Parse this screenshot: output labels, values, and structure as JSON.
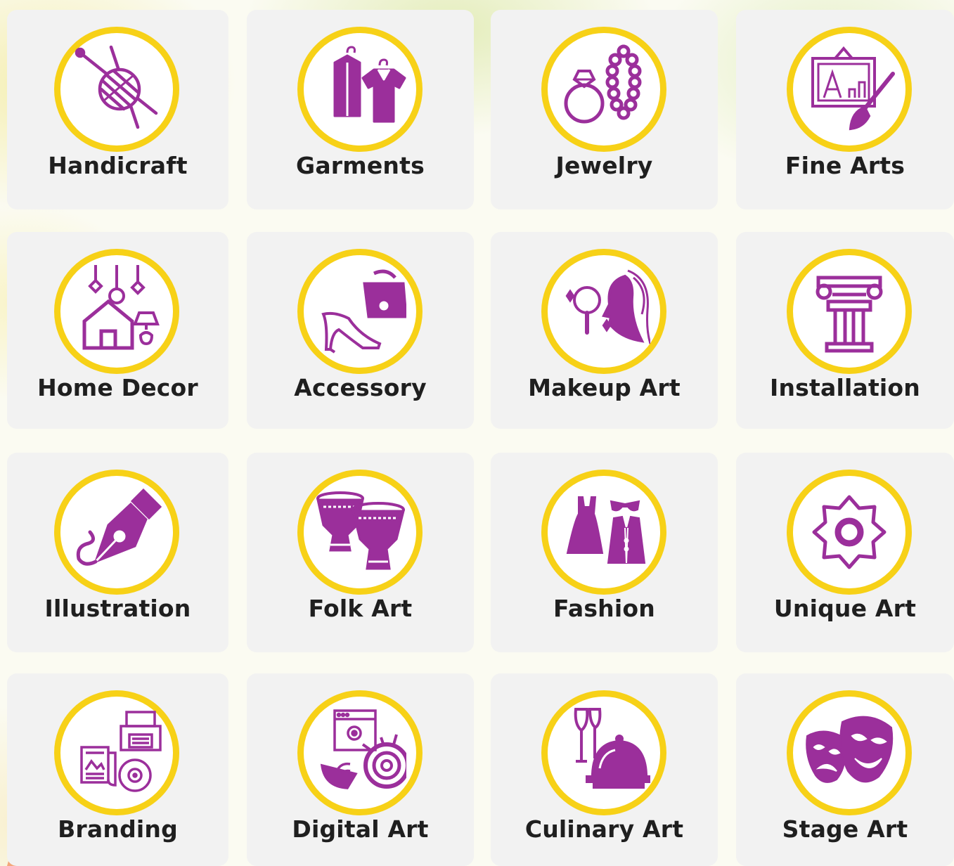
{
  "categories": [
    {
      "label": "Handicraft",
      "icon": "yarn-needles-icon"
    },
    {
      "label": "Garments",
      "icon": "hanging-clothes-icon"
    },
    {
      "label": "Jewelry",
      "icon": "ring-necklace-icon"
    },
    {
      "label": "Fine Arts",
      "icon": "painting-brush-icon"
    },
    {
      "label": "Home Decor",
      "icon": "house-lamps-icon"
    },
    {
      "label": "Accessory",
      "icon": "handbag-heel-icon"
    },
    {
      "label": "Makeup Art",
      "icon": "mirror-face-icon"
    },
    {
      "label": "Installation",
      "icon": "column-pillar-icon"
    },
    {
      "label": "Illustration",
      "icon": "pen-nib-icon"
    },
    {
      "label": "Folk Art",
      "icon": "drums-icon"
    },
    {
      "label": "Fashion",
      "icon": "dress-suit-icon"
    },
    {
      "label": "Unique Art",
      "icon": "flower-badge-icon"
    },
    {
      "label": "Branding",
      "icon": "printer-media-icon"
    },
    {
      "label": "Digital Art",
      "icon": "web-design-icon"
    },
    {
      "label": "Culinary Art",
      "icon": "wine-cloche-icon"
    },
    {
      "label": "Stage Art",
      "icon": "theater-masks-icon"
    }
  ],
  "colors": {
    "ring": "#f7d117",
    "icon": "#9b2f9b",
    "tile": "#f2f2f2",
    "text": "#1f1f1f"
  }
}
